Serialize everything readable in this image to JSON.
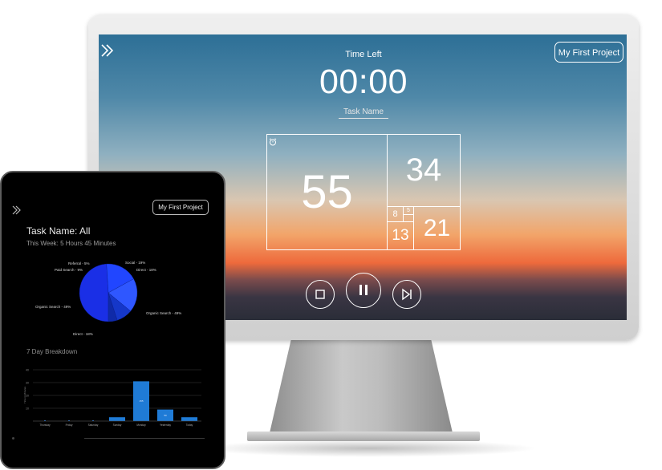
{
  "desktop": {
    "project_button": "My First Project",
    "time_left_label": "Time Left",
    "timer": "00:00",
    "task_name_placeholder": "Task Name",
    "fib_blocks": {
      "b55": "55",
      "b34": "34",
      "b21": "21",
      "b13": "13",
      "b8": "8",
      "b5": "5"
    },
    "controls": [
      "stop",
      "pause",
      "skip-next"
    ]
  },
  "tablet": {
    "project_button": "My First Project",
    "task_title": "Task Name: All",
    "week_summary": "This Week: 5 Hours 45 Minutes",
    "pie_labels": {
      "referral": "Referral - 5%",
      "paid": "Paid Search - 9%",
      "social": "Social - 19%",
      "direct_top": "Direct - 18%",
      "organic_left": "Organic Search - 49%",
      "organic_right": "Organic Search - 49%",
      "direct_bottom": "Direct - 18%"
    },
    "breakdown_title": "7 Day Breakdown"
  },
  "colors": {
    "pie_blue": "#1f3fff",
    "bar_blue": "#1f7bd6"
  },
  "chart_data": [
    {
      "type": "pie",
      "categories": [
        "Organic Search",
        "Direct",
        "Social",
        "Paid Search",
        "Referral"
      ],
      "values": [
        49,
        18,
        19,
        9,
        5
      ]
    },
    {
      "type": "bar",
      "title": "7 Day Breakdown",
      "categories": [
        "Thursday",
        "Friday",
        "Saturday",
        "Sunday",
        "Monday",
        "Yesterday",
        "Today"
      ],
      "values": [
        0,
        0,
        0,
        3,
        31,
        9,
        3
      ],
      "bar_labels": [
        "",
        "",
        "",
        "",
        "155",
        "50",
        ""
      ],
      "yticks": [
        "40",
        "30",
        "20",
        "10",
        ""
      ],
      "ylim": [
        0,
        40
      ],
      "ylabel": "Time in Minutes"
    }
  ]
}
